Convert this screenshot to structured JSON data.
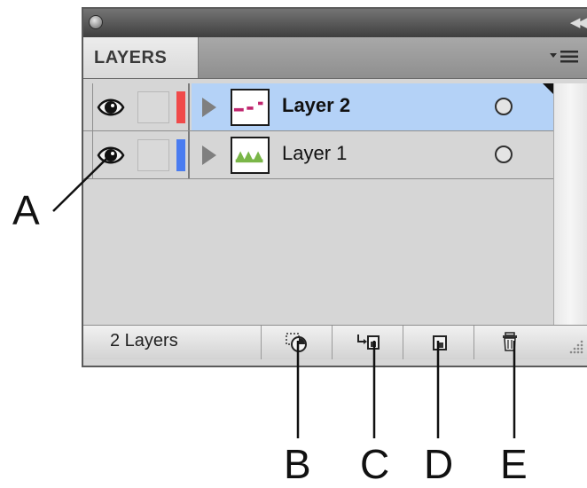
{
  "panel": {
    "tab_label": "LAYERS",
    "layer_count": "2 Layers"
  },
  "layers": [
    {
      "name": "Layer 2",
      "color": "#f04a4a",
      "selected": true
    },
    {
      "name": "Layer 1",
      "color": "#4a7cf0",
      "selected": false
    }
  ],
  "callouts": {
    "a": "A",
    "b": "B",
    "c": "C",
    "d": "D",
    "e": "E"
  },
  "icons": {
    "close": "close-icon",
    "collapse": "double-chevron-left-icon",
    "menu": "panel-menu-icon",
    "eye": "eye-icon",
    "expand": "expand-triangle-icon",
    "target": "target-circle-icon",
    "make_clip": "make-clipping-mask-icon",
    "new_sublayer": "new-sublayer-icon",
    "new_layer": "new-layer-icon",
    "delete": "trash-icon"
  }
}
